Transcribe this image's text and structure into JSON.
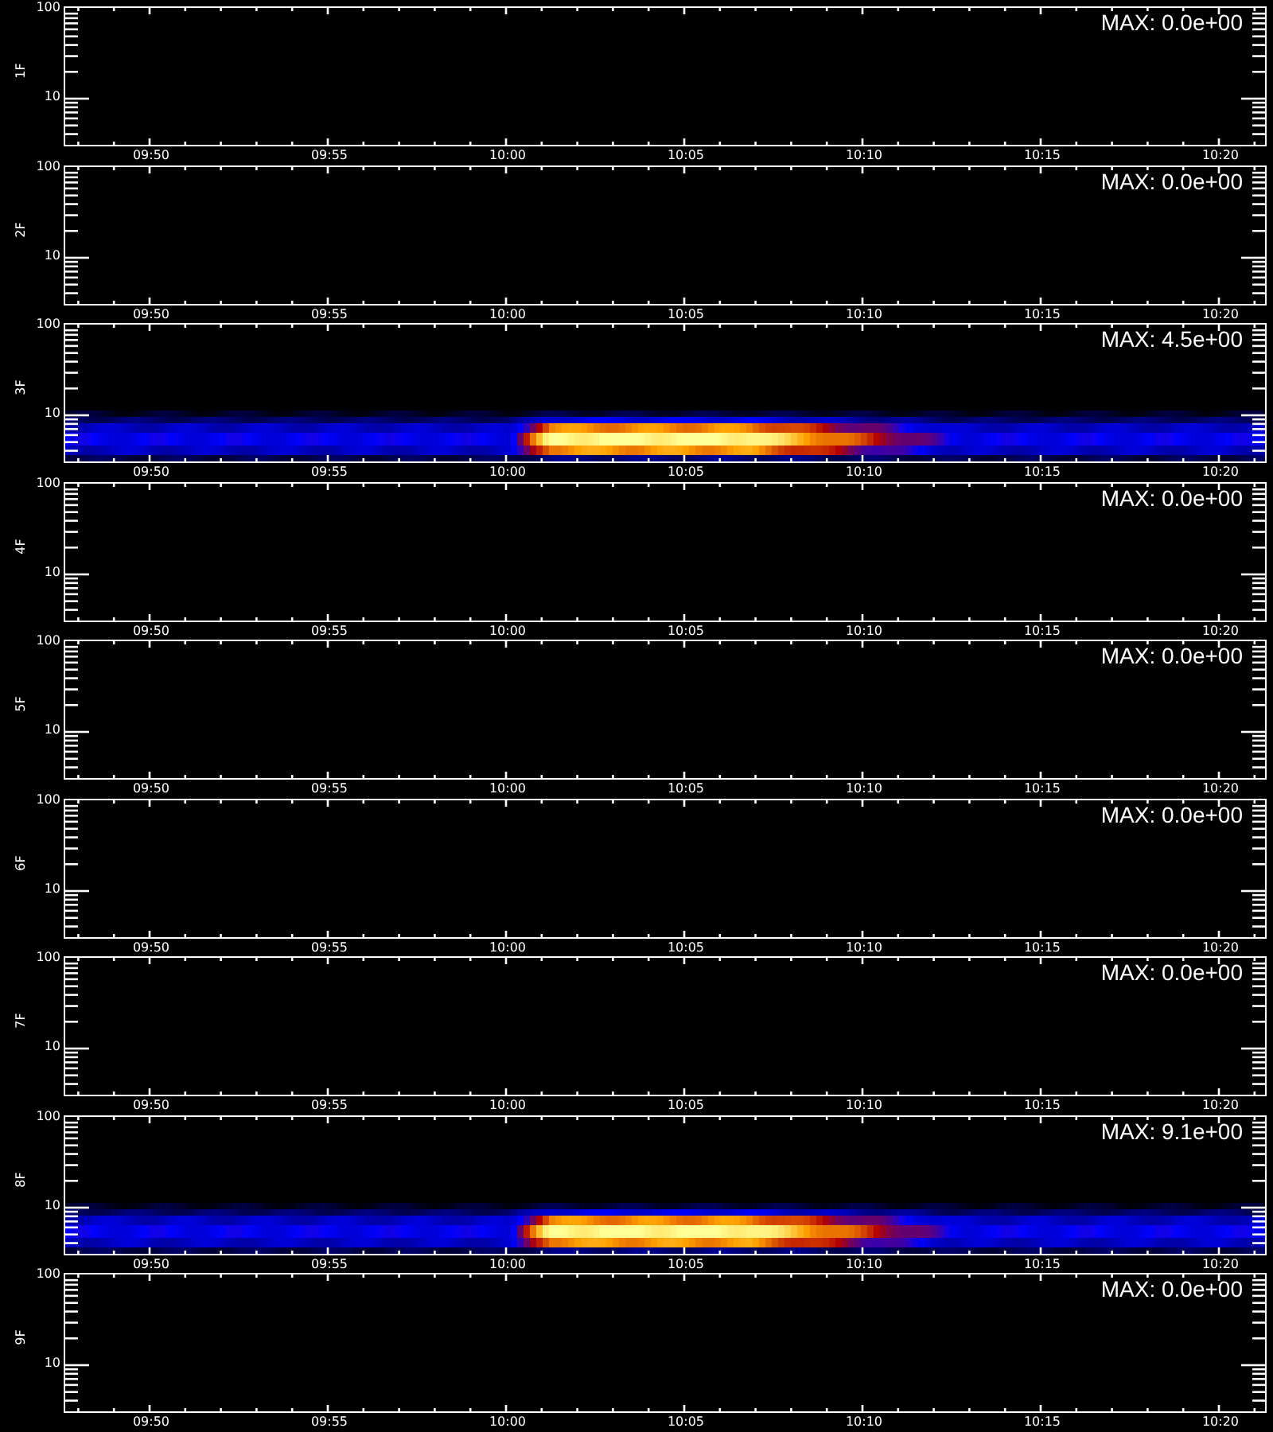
{
  "panels": [
    {
      "channel": "1F",
      "kind": "empty",
      "max": "MAX: 0.0e+00",
      "y_ticks": [
        "100",
        "10"
      ],
      "x_ticks": [
        "09:50",
        "09:55",
        "10:00",
        "10:05",
        "10:10",
        "10:15",
        "10:20"
      ]
    },
    {
      "channel": "2F",
      "kind": "empty",
      "max": "MAX: 0.0e+00",
      "y_ticks": [
        "100",
        "10"
      ],
      "x_ticks": [
        "09:50",
        "09:55",
        "10:00",
        "10:05",
        "10:10",
        "10:15",
        "10:20"
      ]
    },
    {
      "channel": "3F",
      "kind": "signal",
      "max": "MAX: 4.5e+00",
      "y_ticks": [
        "100",
        "10"
      ],
      "x_ticks": [
        "09:50",
        "09:55",
        "10:00",
        "10:05",
        "10:10",
        "10:15",
        "10:20"
      ]
    },
    {
      "channel": "4F",
      "kind": "empty",
      "max": "MAX: 0.0e+00",
      "y_ticks": [
        "100",
        "10"
      ],
      "x_ticks": [
        "09:50",
        "09:55",
        "10:00",
        "10:05",
        "10:10",
        "10:15",
        "10:20"
      ]
    },
    {
      "channel": "5F",
      "kind": "empty",
      "max": "MAX: 0.0e+00",
      "y_ticks": [
        "100",
        "10"
      ],
      "x_ticks": [
        "09:50",
        "09:55",
        "10:00",
        "10:05",
        "10:10",
        "10:15",
        "10:20"
      ]
    },
    {
      "channel": "6F",
      "kind": "empty",
      "max": "MAX: 0.0e+00",
      "y_ticks": [
        "100",
        "10"
      ],
      "x_ticks": [
        "09:50",
        "09:55",
        "10:00",
        "10:05",
        "10:10",
        "10:15",
        "10:20"
      ]
    },
    {
      "channel": "7F",
      "kind": "empty",
      "max": "MAX: 0.0e+00",
      "y_ticks": [
        "100",
        "10"
      ],
      "x_ticks": [
        "09:50",
        "09:55",
        "10:00",
        "10:05",
        "10:10",
        "10:15",
        "10:20"
      ]
    },
    {
      "channel": "8F",
      "kind": "signal",
      "max": "MAX: 9.1e+00",
      "y_ticks": [
        "100",
        "10"
      ],
      "x_ticks": [
        "09:50",
        "09:55",
        "10:00",
        "10:05",
        "10:10",
        "10:15",
        "10:20"
      ]
    },
    {
      "channel": "9F",
      "kind": "empty",
      "max": "MAX: 0.0e+00",
      "y_ticks": [
        "100",
        "10"
      ],
      "x_ticks": [
        "09:50",
        "09:55",
        "10:00",
        "10:05",
        "10:10",
        "10:15",
        "10:20"
      ]
    }
  ]
}
